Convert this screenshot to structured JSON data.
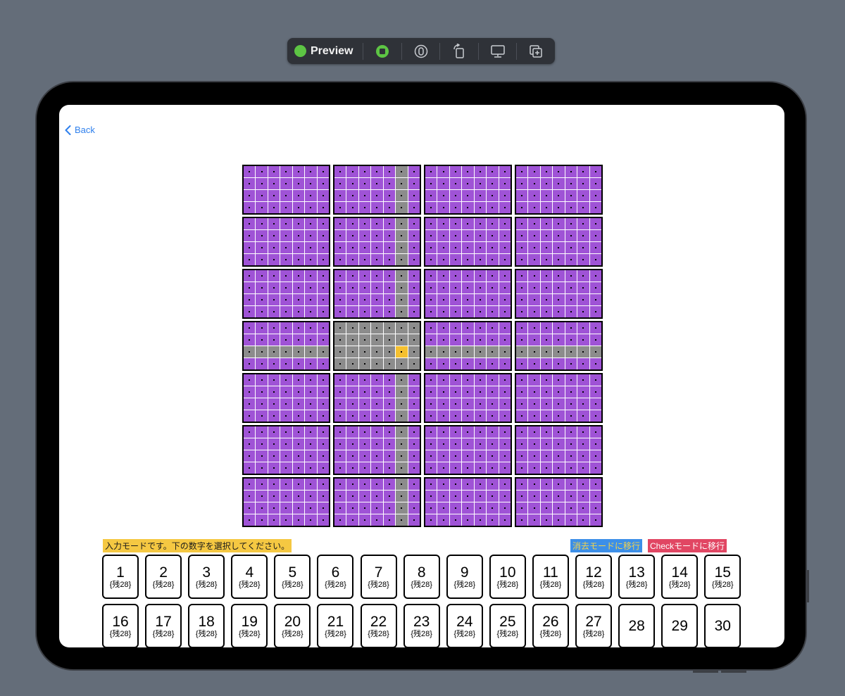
{
  "toolbar": {
    "preview_label": "Preview",
    "buttons": [
      "live-icon",
      "variant-icon",
      "rotate-icon",
      "device-icon",
      "duplicate-icon"
    ]
  },
  "nav": {
    "back_label": "Back"
  },
  "board": {
    "box_columns": 4,
    "box_rows": 7,
    "cell_columns": 7,
    "cell_rows": 4,
    "highlight_box_row": 3,
    "highlight_box_col": 1,
    "highlight_cell_row": 2,
    "highlight_cell_col": 5,
    "colors": {
      "cell": "#9f53d6",
      "related": "#8c8c8c",
      "selected": "#f5c02f"
    }
  },
  "modes": {
    "input_message": "入力モードです。下の数字を選択してください。",
    "erase_button": "消去モードに移行",
    "check_button": "Checkモードに移行"
  },
  "numbers": [
    {
      "n": "1",
      "rem": "{残28}"
    },
    {
      "n": "2",
      "rem": "{残28}"
    },
    {
      "n": "3",
      "rem": "{残28}"
    },
    {
      "n": "4",
      "rem": "{残28}"
    },
    {
      "n": "5",
      "rem": "{残28}"
    },
    {
      "n": "6",
      "rem": "{残28}"
    },
    {
      "n": "7",
      "rem": "{残28}"
    },
    {
      "n": "8",
      "rem": "{残28}"
    },
    {
      "n": "9",
      "rem": "{残28}"
    },
    {
      "n": "10",
      "rem": "{残28}"
    },
    {
      "n": "11",
      "rem": "{残28}"
    },
    {
      "n": "12",
      "rem": "{残28}"
    },
    {
      "n": "13",
      "rem": "{残28}"
    },
    {
      "n": "14",
      "rem": "{残28}"
    },
    {
      "n": "15",
      "rem": "{残28}"
    },
    {
      "n": "16",
      "rem": "{残28}"
    },
    {
      "n": "17",
      "rem": "{残28}"
    },
    {
      "n": "18",
      "rem": "{残28}"
    },
    {
      "n": "19",
      "rem": "{残28}"
    },
    {
      "n": "20",
      "rem": "{残28}"
    },
    {
      "n": "21",
      "rem": "{残28}"
    },
    {
      "n": "22",
      "rem": "{残28}"
    },
    {
      "n": "23",
      "rem": "{残28}"
    },
    {
      "n": "24",
      "rem": "{残28}"
    },
    {
      "n": "25",
      "rem": "{残28}"
    },
    {
      "n": "26",
      "rem": "{残28}"
    },
    {
      "n": "27",
      "rem": "{残28}"
    },
    {
      "n": "28",
      "rem": ""
    },
    {
      "n": "29",
      "rem": ""
    },
    {
      "n": "30",
      "rem": ""
    }
  ]
}
